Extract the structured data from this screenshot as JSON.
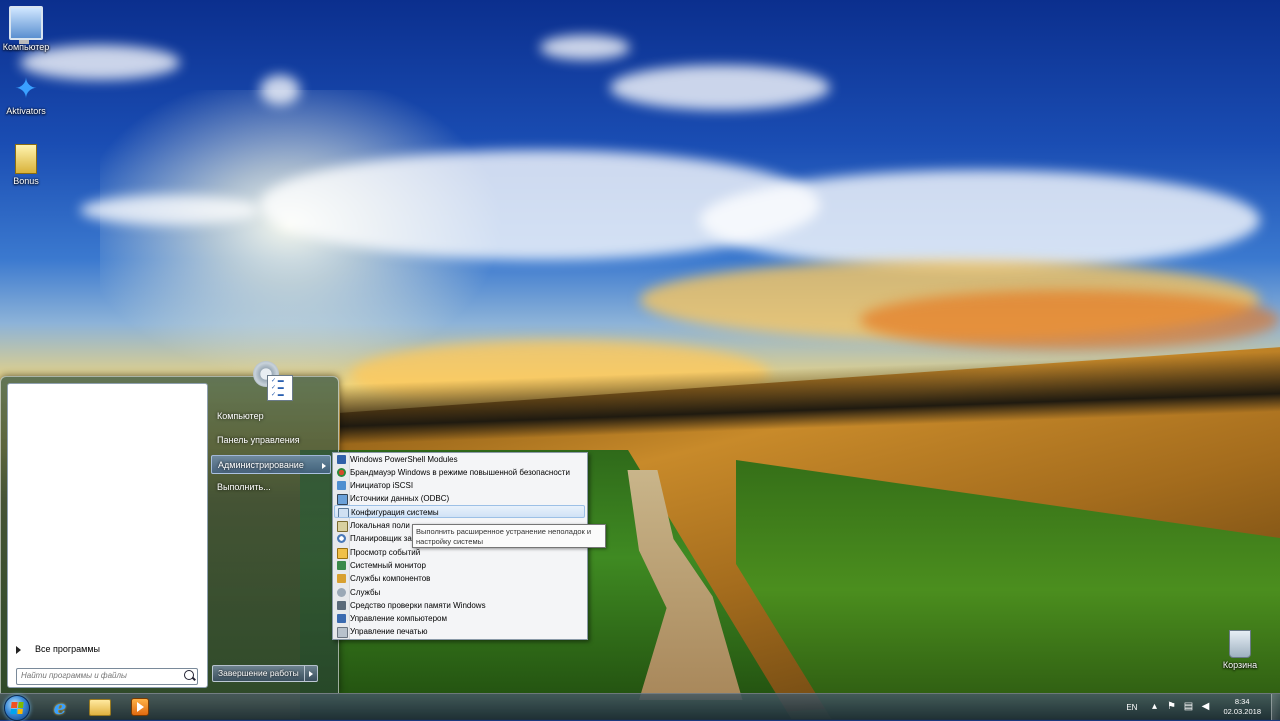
{
  "desktop": {
    "icons": [
      {
        "label": "Компьютер",
        "icon": "computer-icon"
      },
      {
        "label": "Aktivators",
        "icon": "star-icon"
      },
      {
        "label": "Bonus",
        "icon": "document-icon"
      }
    ],
    "recycle_bin": {
      "label": "Корзина",
      "icon": "recycle-bin-icon"
    }
  },
  "start_menu": {
    "all_programs": "Все программы",
    "search_placeholder": "Найти программы и файлы",
    "right_items": [
      {
        "label": "Компьютер"
      },
      {
        "label": "Панель управления"
      },
      {
        "label": "Администрирование",
        "has_submenu": true,
        "selected": true
      },
      {
        "label": "Выполнить..."
      }
    ],
    "shutdown_label": "Завершение работы"
  },
  "admin_submenu": {
    "items": [
      {
        "label": "Windows PowerShell Modules",
        "icon": "powershell-icon"
      },
      {
        "label": "Брандмауэр Windows в режиме повышенной безопасности",
        "icon": "firewall-icon"
      },
      {
        "label": "Инициатор iSCSI",
        "icon": "iscsi-icon"
      },
      {
        "label": "Источники данных (ODBC)",
        "icon": "odbc-icon"
      },
      {
        "label": "Конфигурация системы",
        "icon": "system-config-icon",
        "highlighted": true
      },
      {
        "label": "Локальная поли",
        "icon": "local-policy-icon"
      },
      {
        "label": "Планировщик за",
        "icon": "scheduler-icon"
      },
      {
        "label": "Просмотр событий",
        "icon": "event-viewer-icon"
      },
      {
        "label": "Системный монитор",
        "icon": "system-monitor-icon"
      },
      {
        "label": "Службы компонентов",
        "icon": "component-services-icon"
      },
      {
        "label": "Службы",
        "icon": "services-icon"
      },
      {
        "label": "Средство проверки памяти Windows",
        "icon": "memory-check-icon"
      },
      {
        "label": "Управление компьютером",
        "icon": "computer-management-icon"
      },
      {
        "label": "Управление печатью",
        "icon": "print-management-icon"
      }
    ],
    "tooltip": "Выполнить расширенное устранение неполадок и настройку системы"
  },
  "taskbar": {
    "pinned": [
      {
        "name": "internet-explorer",
        "icon": "ie-icon"
      },
      {
        "name": "windows-explorer",
        "icon": "folder-icon"
      },
      {
        "name": "media-player",
        "icon": "media-player-icon"
      }
    ],
    "tray": {
      "language": "EN",
      "time": "8:34",
      "date": "02.03.2018"
    }
  },
  "colors": {
    "orb_blue": "#3a8ad8",
    "flag_red": "#f25022",
    "flag_green": "#7fba00",
    "flag_blue": "#00a4ef",
    "flag_yellow": "#ffb900"
  }
}
